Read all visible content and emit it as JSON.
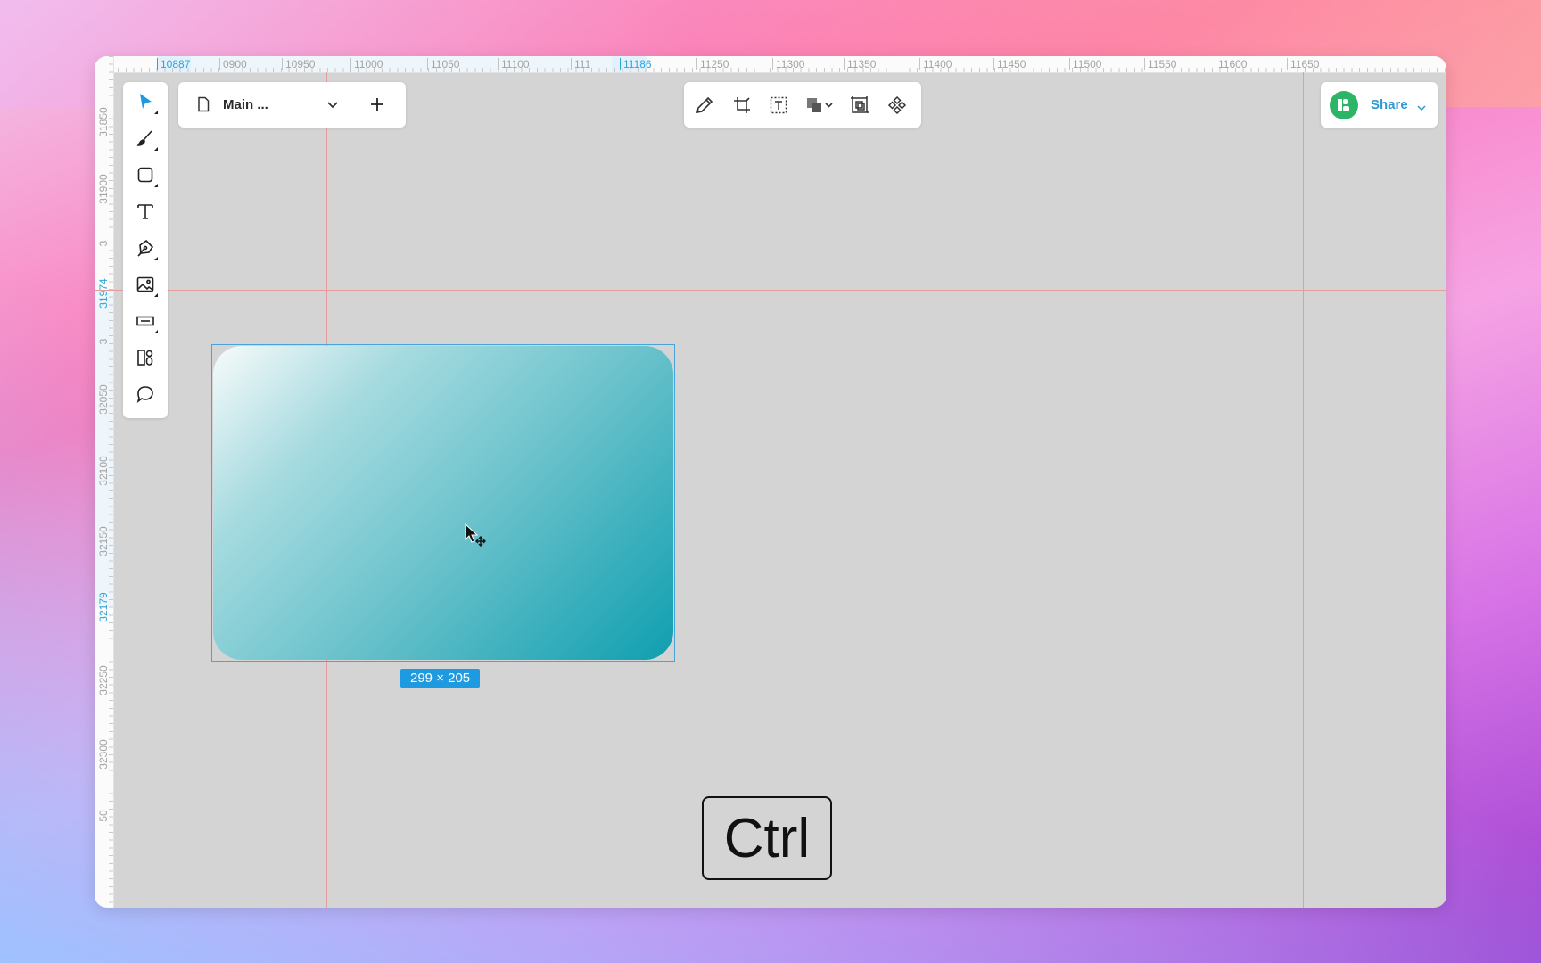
{
  "ruler": {
    "top_ticks": [
      {
        "label": "10887",
        "active": true
      },
      {
        "label": "0900",
        "active": false
      },
      {
        "label": "10950",
        "active": false
      },
      {
        "label": "11000",
        "active": false
      },
      {
        "label": "11050",
        "active": false
      },
      {
        "label": "11100",
        "active": false
      },
      {
        "label": "111",
        "active": false
      },
      {
        "label": "11186",
        "active": true
      },
      {
        "label": "11250",
        "active": false
      },
      {
        "label": "11300",
        "active": false
      },
      {
        "label": "11350",
        "active": false
      },
      {
        "label": "11400",
        "active": false
      },
      {
        "label": "11450",
        "active": false
      },
      {
        "label": "11500",
        "active": false
      },
      {
        "label": "11550",
        "active": false
      },
      {
        "label": "11600",
        "active": false
      },
      {
        "label": "11650",
        "active": false
      }
    ],
    "left_ticks": [
      {
        "label": "31850",
        "active": false
      },
      {
        "label": "31900",
        "active": false
      },
      {
        "label": "3",
        "active": false
      },
      {
        "label": "31974",
        "active": true
      },
      {
        "label": "3",
        "active": false
      },
      {
        "label": "32050",
        "active": false
      },
      {
        "label": "32100",
        "active": false
      },
      {
        "label": "32150",
        "active": false
      },
      {
        "label": "32179",
        "active": true
      },
      {
        "label": "32250",
        "active": false
      },
      {
        "label": "32300",
        "active": false
      },
      {
        "label": "50",
        "active": false
      }
    ]
  },
  "toolbar": {
    "tools": [
      {
        "name": "move-tool",
        "icon": "cursor-arrow-icon",
        "active": true,
        "submenu": true
      },
      {
        "name": "brush-tool",
        "icon": "brush-icon",
        "active": false,
        "submenu": true
      },
      {
        "name": "rectangle-tool",
        "icon": "rectangle-icon",
        "active": false,
        "submenu": true
      },
      {
        "name": "text-tool",
        "icon": "text-icon",
        "active": false,
        "submenu": false
      },
      {
        "name": "pen-tool",
        "icon": "pen-nib-icon",
        "active": false,
        "submenu": true
      },
      {
        "name": "image-tool",
        "icon": "image-icon",
        "active": false,
        "submenu": true
      },
      {
        "name": "component-tool",
        "icon": "input-field-icon",
        "active": false,
        "submenu": true
      },
      {
        "name": "assets-tool",
        "icon": "assets-icon",
        "active": false,
        "submenu": false
      },
      {
        "name": "comment-tool",
        "icon": "comment-icon",
        "active": false,
        "submenu": false
      }
    ]
  },
  "page_selector": {
    "page_name": "Main ...",
    "icon": "document-icon"
  },
  "top_tools": [
    {
      "name": "edit-tool",
      "icon": "pencil-icon"
    },
    {
      "name": "crop-tool",
      "icon": "crop-icon"
    },
    {
      "name": "text-box-tool",
      "icon": "text-frame-icon"
    },
    {
      "name": "boolean-tool",
      "icon": "boolean-shapes-icon"
    },
    {
      "name": "frame-tool",
      "icon": "frame-selection-icon"
    },
    {
      "name": "component-create-tool",
      "icon": "component-diamond-icon"
    }
  ],
  "share": {
    "label": "Share",
    "avatar_icon": "brand-logo-icon",
    "avatar_color": "#2cb566"
  },
  "selection": {
    "dimensions": "299 × 205",
    "accent": "#1e9be0"
  },
  "key_indicator": {
    "label": "Ctrl"
  }
}
